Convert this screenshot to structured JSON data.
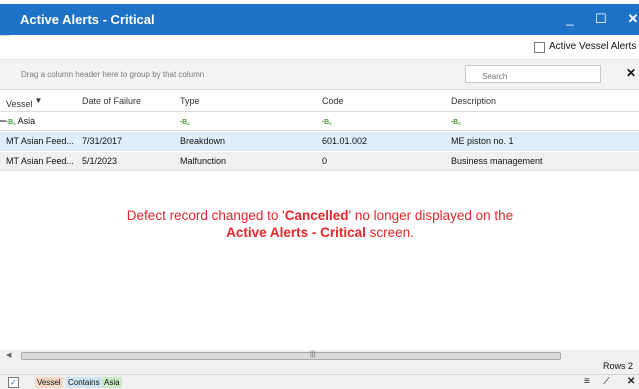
{
  "window": {
    "title": "Active Alerts - Critical",
    "min_glyph": "_",
    "max_glyph": "☐",
    "close_glyph": "✕"
  },
  "toolbar": {
    "vessel_only_label": "Active Vessel Alerts Only",
    "vessel_only_checked": false
  },
  "grouping": {
    "hint": "Drag a column header here to group by that column",
    "search_placeholder": "Search",
    "clear_glyph": "✕"
  },
  "columns": [
    {
      "label": "Vessel",
      "icon": "filter-icon"
    },
    {
      "label": "Date of Failure"
    },
    {
      "label": "Type"
    },
    {
      "label": "Code"
    },
    {
      "label": "Description"
    }
  ],
  "filter_row": {
    "icon": "filter-contains-icon",
    "icon_glyph": "ꞏB꜀",
    "vessel_value": "Asia"
  },
  "rows": [
    {
      "vessel": "MT Asian Feed...",
      "date": "7/31/2017",
      "type": "Breakdown",
      "code": "601.01.002",
      "description": "ME piston no. 1",
      "selected": true
    },
    {
      "vessel": "MT Asian Feed...",
      "date": "5/1/2023",
      "type": "Malfunction",
      "code": "0",
      "description": "Business management",
      "selected": false
    }
  ],
  "annotation": {
    "line1_prefix": "Defect record changed to '",
    "line1_bold": "Cancelled",
    "line1_suffix": "' no longer displayed on the",
    "line2_bold": "Active Alerts - Critical",
    "line2_suffix": " screen."
  },
  "status": {
    "rows_label": "Rows 2"
  },
  "footer": {
    "filter_enabled": true,
    "check_glyph": "✓",
    "filter_field": "Vessel",
    "filter_operator": "Contains",
    "filter_value": "Asia",
    "icons": [
      "filter-editor-icon",
      "edit-filter-icon",
      "clear-filter-icon"
    ],
    "icon_glyphs": [
      "≡",
      "⁄",
      "✕"
    ]
  },
  "colors": {
    "titlebar": "#1e72c8",
    "annotation": "#e6262a",
    "selected_row": "#e0eefb"
  }
}
